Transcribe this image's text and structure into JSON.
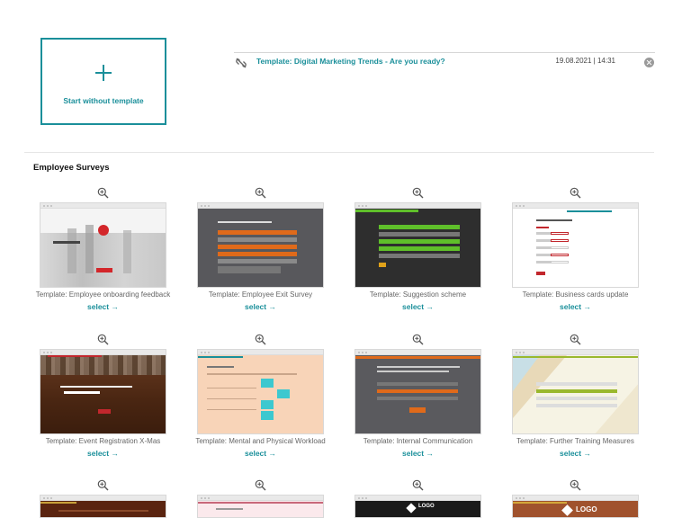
{
  "start_card": {
    "label": "Start without template"
  },
  "recent": {
    "title": "Template: Digital Marketing Trends - Are you ready?",
    "date": "19.08.2021 | 14:31"
  },
  "section": {
    "title": "Employee Surveys"
  },
  "select_label": "select →",
  "templates": [
    {
      "name": "Template: Employee onboarding feedback"
    },
    {
      "name": "Template: Employee Exit Survey"
    },
    {
      "name": "Template: Suggestion scheme"
    },
    {
      "name": "Template: Business cards update"
    },
    {
      "name": "Template: Event Registration X-Mas"
    },
    {
      "name": "Template: Mental and Physical Workload"
    },
    {
      "name": "Template: Internal Communication"
    },
    {
      "name": "Template: Further Training Measures"
    },
    {
      "name": ""
    },
    {
      "name": ""
    },
    {
      "name": ""
    },
    {
      "name": ""
    }
  ],
  "thumb_text": {
    "logo_1": "LOGO",
    "logo_2": "LOGO"
  },
  "colors": {
    "accent": "#1a8f9a"
  }
}
